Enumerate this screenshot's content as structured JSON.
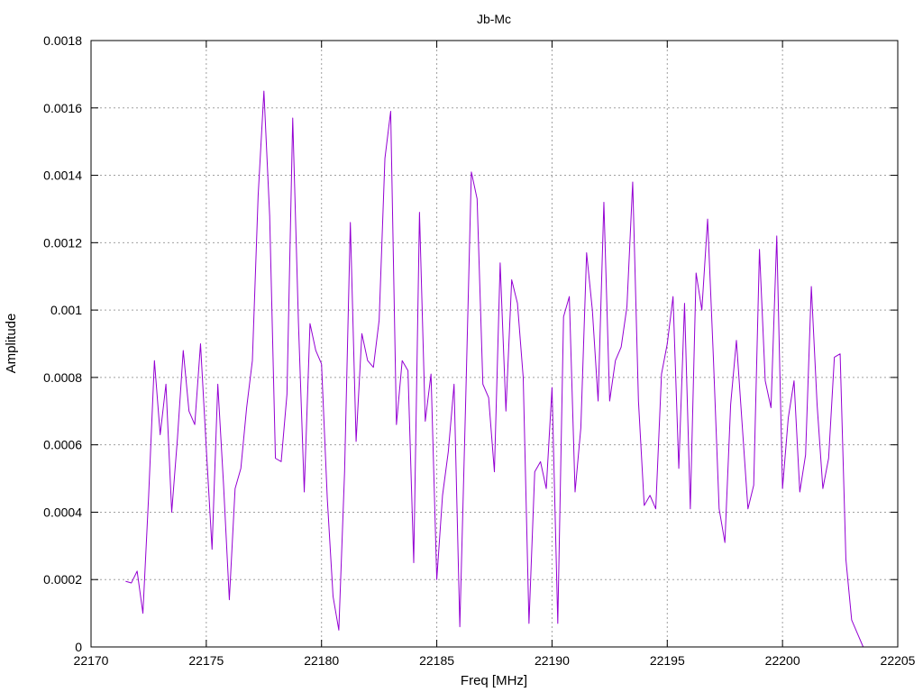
{
  "chart_data": {
    "type": "line",
    "title": "Jb-Mc",
    "xlabel": "Freq [MHz]",
    "ylabel": "Amplitude",
    "xlim": [
      22170,
      22205
    ],
    "ylim": [
      0,
      0.0018
    ],
    "x_ticks": [
      "22170",
      "22175",
      "22180",
      "22185",
      "22190",
      "22195",
      "22200",
      "22205"
    ],
    "y_ticks": [
      "0",
      "0.0002",
      "0.0004",
      "0.0006",
      "0.0008",
      "0.001",
      "0.0012",
      "0.0014",
      "0.0016",
      "0.0018"
    ],
    "grid": true,
    "line_color": "#9400d3",
    "series": [
      {
        "x": [
          22171.5,
          22171.75,
          22172.0,
          22172.25,
          22172.5,
          22172.75,
          22173.0,
          22173.25,
          22173.5,
          22173.75,
          22174.0,
          22174.25,
          22174.5,
          22174.75,
          22175.0,
          22175.25,
          22175.5,
          22175.75,
          22176.0,
          22176.25,
          22176.5,
          22176.75,
          22177.0,
          22177.25,
          22177.5,
          22177.75,
          22178.0,
          22178.25,
          22178.5,
          22178.75,
          22179.0,
          22179.25,
          22179.5,
          22179.75,
          22180.0,
          22180.25,
          22180.5,
          22180.75,
          22181.0,
          22181.25,
          22181.5,
          22181.75,
          22182.0,
          22182.25,
          22182.5,
          22182.75,
          22183.0,
          22183.25,
          22183.5,
          22183.75,
          22184.0,
          22184.25,
          22184.5,
          22184.75,
          22185.0,
          22185.25,
          22185.5,
          22185.75,
          22186.0,
          22186.25,
          22186.5,
          22186.75,
          22187.0,
          22187.25,
          22187.5,
          22187.75,
          22188.0,
          22188.25,
          22188.5,
          22188.75,
          22189.0,
          22189.25,
          22189.5,
          22189.75,
          22190.0,
          22190.25,
          22190.5,
          22190.75,
          22191.0,
          22191.25,
          22191.5,
          22191.75,
          22192.0,
          22192.25,
          22192.5,
          22192.75,
          22193.0,
          22193.25,
          22193.5,
          22193.75,
          22194.0,
          22194.25,
          22194.5,
          22194.75,
          22195.0,
          22195.25,
          22195.5,
          22195.75,
          22196.0,
          22196.25,
          22196.5,
          22196.75,
          22197.0,
          22197.25,
          22197.5,
          22197.75,
          22198.0,
          22198.25,
          22198.5,
          22198.75,
          22199.0,
          22199.25,
          22199.5,
          22199.75,
          22200.0,
          22200.25,
          22200.5,
          22200.75,
          22201.0,
          22201.25,
          22201.5,
          22201.75,
          22202.0,
          22202.25,
          22202.5,
          22202.75,
          22203.0,
          22203.25,
          22203.5
        ],
        "y": [
          0.000195,
          0.00019,
          0.000225,
          0.0001,
          0.00045,
          0.00085,
          0.00063,
          0.00078,
          0.0004,
          0.00062,
          0.00088,
          0.0007,
          0.00066,
          0.0009,
          0.00059,
          0.00029,
          0.00078,
          0.00048,
          0.00014,
          0.00047,
          0.00053,
          0.00071,
          0.00085,
          0.00134,
          0.00165,
          0.00128,
          0.00056,
          0.00055,
          0.00075,
          0.00157,
          0.00096,
          0.00046,
          0.00096,
          0.00088,
          0.00084,
          0.00044,
          0.00015,
          5e-05,
          0.00052,
          0.00126,
          0.00061,
          0.00093,
          0.00085,
          0.00083,
          0.00097,
          0.00145,
          0.00159,
          0.00066,
          0.00085,
          0.00082,
          0.00025,
          0.00129,
          0.00067,
          0.00081,
          0.0002,
          0.00045,
          0.00058,
          0.00078,
          6e-05,
          0.00072,
          0.00141,
          0.00133,
          0.00078,
          0.00074,
          0.00052,
          0.00114,
          0.0007,
          0.00109,
          0.00102,
          0.0008,
          7e-05,
          0.00052,
          0.00055,
          0.00047,
          0.00077,
          7e-05,
          0.00098,
          0.00104,
          0.00046,
          0.00065,
          0.00117,
          0.001,
          0.00073,
          0.00132,
          0.00073,
          0.00085,
          0.00089,
          0.00101,
          0.00138,
          0.00073,
          0.00042,
          0.00045,
          0.00041,
          0.00081,
          0.0009,
          0.00104,
          0.00053,
          0.00102,
          0.00041,
          0.00111,
          0.001,
          0.00127,
          0.00086,
          0.00041,
          0.00031,
          0.00072,
          0.00091,
          0.00066,
          0.00041,
          0.00048,
          0.00118,
          0.00079,
          0.00071,
          0.00122,
          0.00047,
          0.00068,
          0.00079,
          0.00046,
          0.00057,
          0.00107,
          0.00072,
          0.00047,
          0.00056,
          0.00086,
          0.00087,
          0.00026,
          8e-05,
          4e-05,
          0.0
        ]
      }
    ]
  }
}
